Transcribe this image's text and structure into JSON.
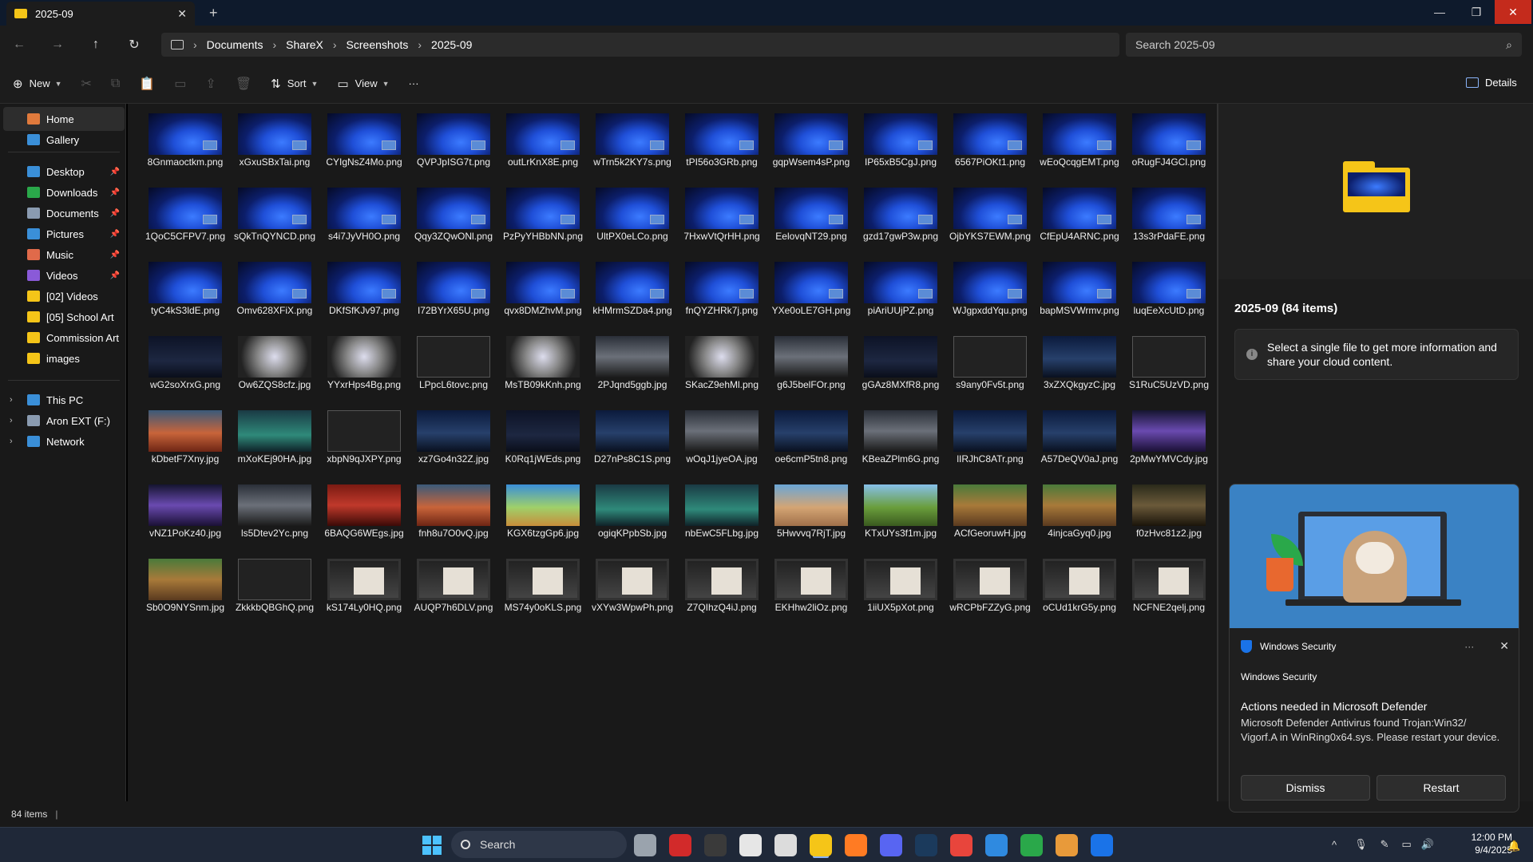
{
  "window": {
    "tab_title": "2025-09",
    "tab_close": "✕",
    "new_tab": "+",
    "minimize": "—",
    "maximize": "❐",
    "close": "✕"
  },
  "nav": {
    "back": "←",
    "forward": "→",
    "up": "↑",
    "refresh": "↻"
  },
  "breadcrumb": [
    "Documents",
    "ShareX",
    "Screenshots",
    "2025-09"
  ],
  "search": {
    "placeholder": "Search 2025-09",
    "icon": "search-icon"
  },
  "toolbar": {
    "new_label": "New",
    "sort_label": "Sort",
    "view_label": "View",
    "more_label": "···",
    "details_label": "Details",
    "icons": [
      "cut-icon",
      "copy-icon",
      "paste-icon",
      "rename-icon",
      "share-icon",
      "delete-icon"
    ]
  },
  "sidebar": {
    "items": [
      {
        "label": "Home",
        "icon": "home-icon",
        "color": "#e07a3c",
        "pinned": false
      },
      {
        "label": "Gallery",
        "icon": "gallery-icon",
        "color": "#3a8fd8",
        "pinned": false
      },
      {
        "label": "Desktop",
        "icon": "desktop-icon",
        "color": "#3a8fd8",
        "pinned": true
      },
      {
        "label": "Downloads",
        "icon": "download-icon",
        "color": "#2aa84a",
        "pinned": true
      },
      {
        "label": "Documents",
        "icon": "document-icon",
        "color": "#8a9bb0",
        "pinned": true
      },
      {
        "label": "Pictures",
        "icon": "picture-icon",
        "color": "#3a8fd8",
        "pinned": true
      },
      {
        "label": "Music",
        "icon": "music-icon",
        "color": "#e06a4a",
        "pinned": true
      },
      {
        "label": "Videos",
        "icon": "video-icon",
        "color": "#8a5ad8",
        "pinned": true
      },
      {
        "label": "[02] Videos",
        "icon": "folder-icon",
        "color": "#f5c518",
        "pinned": false
      },
      {
        "label": "[05] School Art",
        "icon": "folder-icon",
        "color": "#f5c518",
        "pinned": false
      },
      {
        "label": "Commission Art",
        "icon": "folder-icon",
        "color": "#f5c518",
        "pinned": false
      },
      {
        "label": "images",
        "icon": "folder-icon",
        "color": "#f5c518",
        "pinned": false
      },
      {
        "label": "This PC",
        "icon": "pc-icon",
        "color": "#3a8fd8",
        "pinned": false
      },
      {
        "label": "Aron EXT (F:)",
        "icon": "drive-icon",
        "color": "#8a9bb0",
        "pinned": false
      },
      {
        "label": "Network",
        "icon": "network-icon",
        "color": "#3a8fd8",
        "pinned": false
      }
    ],
    "pin_glyph": "📌",
    "expand_glyph": "›"
  },
  "files": [
    "8Gnmaoctkm.png",
    "xGxuSBxTai.png",
    "CYIgNsZ4Mo.png",
    "QVPJpISG7t.png",
    "outLrKnX8E.png",
    "wTrn5k2KY7s.png",
    "tPI56o3GRb.png",
    "gqpWsem4sP.png",
    "IP65xB5CgJ.png",
    "6567PiOKt1.png",
    "wEoQcqgEMT.png",
    "oRugFJ4GCl.png",
    "1QoC5CFPV7.png",
    "sQkTnQYNCD.png",
    "s4i7JyVH0O.png",
    "Qqy3ZQwONl.png",
    "PzPyYHBbNN.png",
    "UltPX0eLCo.png",
    "7HxwVtQrHH.png",
    "EelovqNT29.png",
    "gzd17gwP3w.png",
    "OjbYKS7EWM.png",
    "CfEpU4ARNC.png",
    "13s3rPdaFE.png",
    "tyC4kS3ldE.png",
    "Omv628XFiX.png",
    "DKfSfKJv97.png",
    "I72BYrX65U.png",
    "qvx8DMZhvM.png",
    "kHMrmSZDa4.png",
    "fnQYZHRk7j.png",
    "YXe0oLE7GH.png",
    "piAriUUjPZ.png",
    "WJgpxddYqu.png",
    "bapMSVWrmv.png",
    "luqEeXcUtD.png",
    "wG2soXrxG.png",
    "Ow6ZQS8cfz.jpg",
    "YYxrHps4Bg.png",
    "LPpcL6tovc.png",
    "MsTB09kKnh.png",
    "2PJqnd5ggb.jpg",
    "SKacZ9ehMl.png",
    "g6J5belFOr.png",
    "gGAz8MXfR8.png",
    "s9any0Fv5t.png",
    "3xZXQkgyzC.jpg",
    "S1RuC5UzVD.png",
    "kDbetF7Xny.jpg",
    "mXoKEj90HA.jpg",
    "xbpN9qJXPY.png",
    "xz7Go4n32Z.jpg",
    "K0Rq1jWEds.png",
    "D27nPs8C1S.png",
    "wOqJ1jyeOA.jpg",
    "oe6cmP5tn8.png",
    "KBeaZPlm6G.png",
    "lIRJhC8ATr.png",
    "A57DeQV0aJ.png",
    "2pMwYMVCdy.jpg",
    "vNZ1PoKz40.jpg",
    "ls5Dtev2Yc.png",
    "6BAQG6WEgs.jpg",
    "fnh8u7O0vQ.jpg",
    "KGX6tzgGp6.jpg",
    "ogiqKPpbSb.jpg",
    "nbEwC5FLbg.jpg",
    "5Hwvvq7RjT.jpg",
    "KTxUYs3f1m.jpg",
    "ACfGeoruwH.jpg",
    "4injcaGyq0.jpg",
    "f0zHvc81z2.jpg",
    "Sb0O9NYSnm.jpg",
    "ZkkkbQBGhQ.png",
    "kS174Ly0HQ.png",
    "AUQP7h6DLV.png",
    "MS74y0oKLS.png",
    "vXYw3WpwPh.png",
    "Z7QIhzQ4iJ.png",
    "EKHhw2liOz.png",
    "1iiUX5pXot.png",
    "wRCPbFZZyG.png",
    "oCUd1krG5y.png",
    "NCFNE2qelj.png"
  ],
  "thumb_styles": [
    "wp",
    "wp",
    "wp",
    "wp",
    "wp",
    "wp",
    "wp",
    "wp",
    "wp",
    "wp",
    "wp",
    "wp",
    "wp",
    "wp",
    "wp",
    "wp",
    "wp",
    "wp",
    "wp",
    "wp",
    "wp",
    "wp",
    "wp",
    "wp",
    "wp",
    "wp",
    "wp",
    "wp",
    "wp",
    "wp",
    "wp",
    "wp",
    "wp",
    "wp",
    "wp",
    "wp",
    "dk",
    "wh",
    "wh",
    "ui",
    "wh",
    "gy",
    "wh",
    "gy",
    "dk",
    "ui",
    "bl",
    "ui",
    "or",
    "gn",
    "ui",
    "bl",
    "dk",
    "bl",
    "gy",
    "bl",
    "gy",
    "bl",
    "bl",
    "pr",
    "pr",
    "gy",
    "rd",
    "or",
    "sk",
    "gn",
    "gn",
    "sd",
    "gr",
    "fm",
    "fm",
    "dr",
    "fm",
    "ui",
    "pt",
    "pt",
    "pt",
    "pt",
    "pt",
    "pt",
    "pt",
    "pt",
    "pt",
    "pt"
  ],
  "details_pane": {
    "title": "2025-09 (84 items)",
    "info_icon": "i",
    "info_text": "Select a single file to get more information and share your cloud content."
  },
  "status": {
    "item_count": "84 items"
  },
  "toast": {
    "app_name": "Windows Security",
    "more": "···",
    "close": "✕",
    "subtitle": "Windows Security",
    "heading": "Actions needed in Microsoft Defender",
    "body": "Microsoft Defender Antivirus found Trojan:Win32/ Vigorf.A in WinRing0x64.sys. Please restart your device.",
    "dismiss_label": "Dismiss",
    "restart_label": "Restart"
  },
  "taskbar": {
    "search_label": "Search",
    "apps": [
      {
        "name": "task-view-icon",
        "color": "#9aa3ad"
      },
      {
        "name": "voicemeeter-icon",
        "color": "#d22a2a"
      },
      {
        "name": "obs-icon",
        "color": "#3a3a3a"
      },
      {
        "name": "chatgpt-icon",
        "color": "#e6e6e6"
      },
      {
        "name": "sharex-icon",
        "color": "#dcdcdc"
      },
      {
        "name": "file-explorer-icon",
        "color": "#f5c518"
      },
      {
        "name": "firefox-icon",
        "color": "#ff7b23"
      },
      {
        "name": "discord-icon",
        "color": "#5865f2"
      },
      {
        "name": "steam-icon",
        "color": "#1b3a5c"
      },
      {
        "name": "chrome-icon",
        "color": "#e8453c"
      },
      {
        "name": "vscode-icon",
        "color": "#2f8ae0"
      },
      {
        "name": "chrome-beta-icon",
        "color": "#2aa84a"
      },
      {
        "name": "mod-tool-icon",
        "color": "#e89a3a"
      },
      {
        "name": "windows-security-icon",
        "color": "#1a73e8"
      }
    ],
    "tray": {
      "chevron": "^",
      "mic": "🎙",
      "pen": "✎",
      "display": "▭",
      "volume": "🔊"
    },
    "time": "12:00 PM",
    "date": "9/4/2025",
    "notifications": "🔔"
  }
}
